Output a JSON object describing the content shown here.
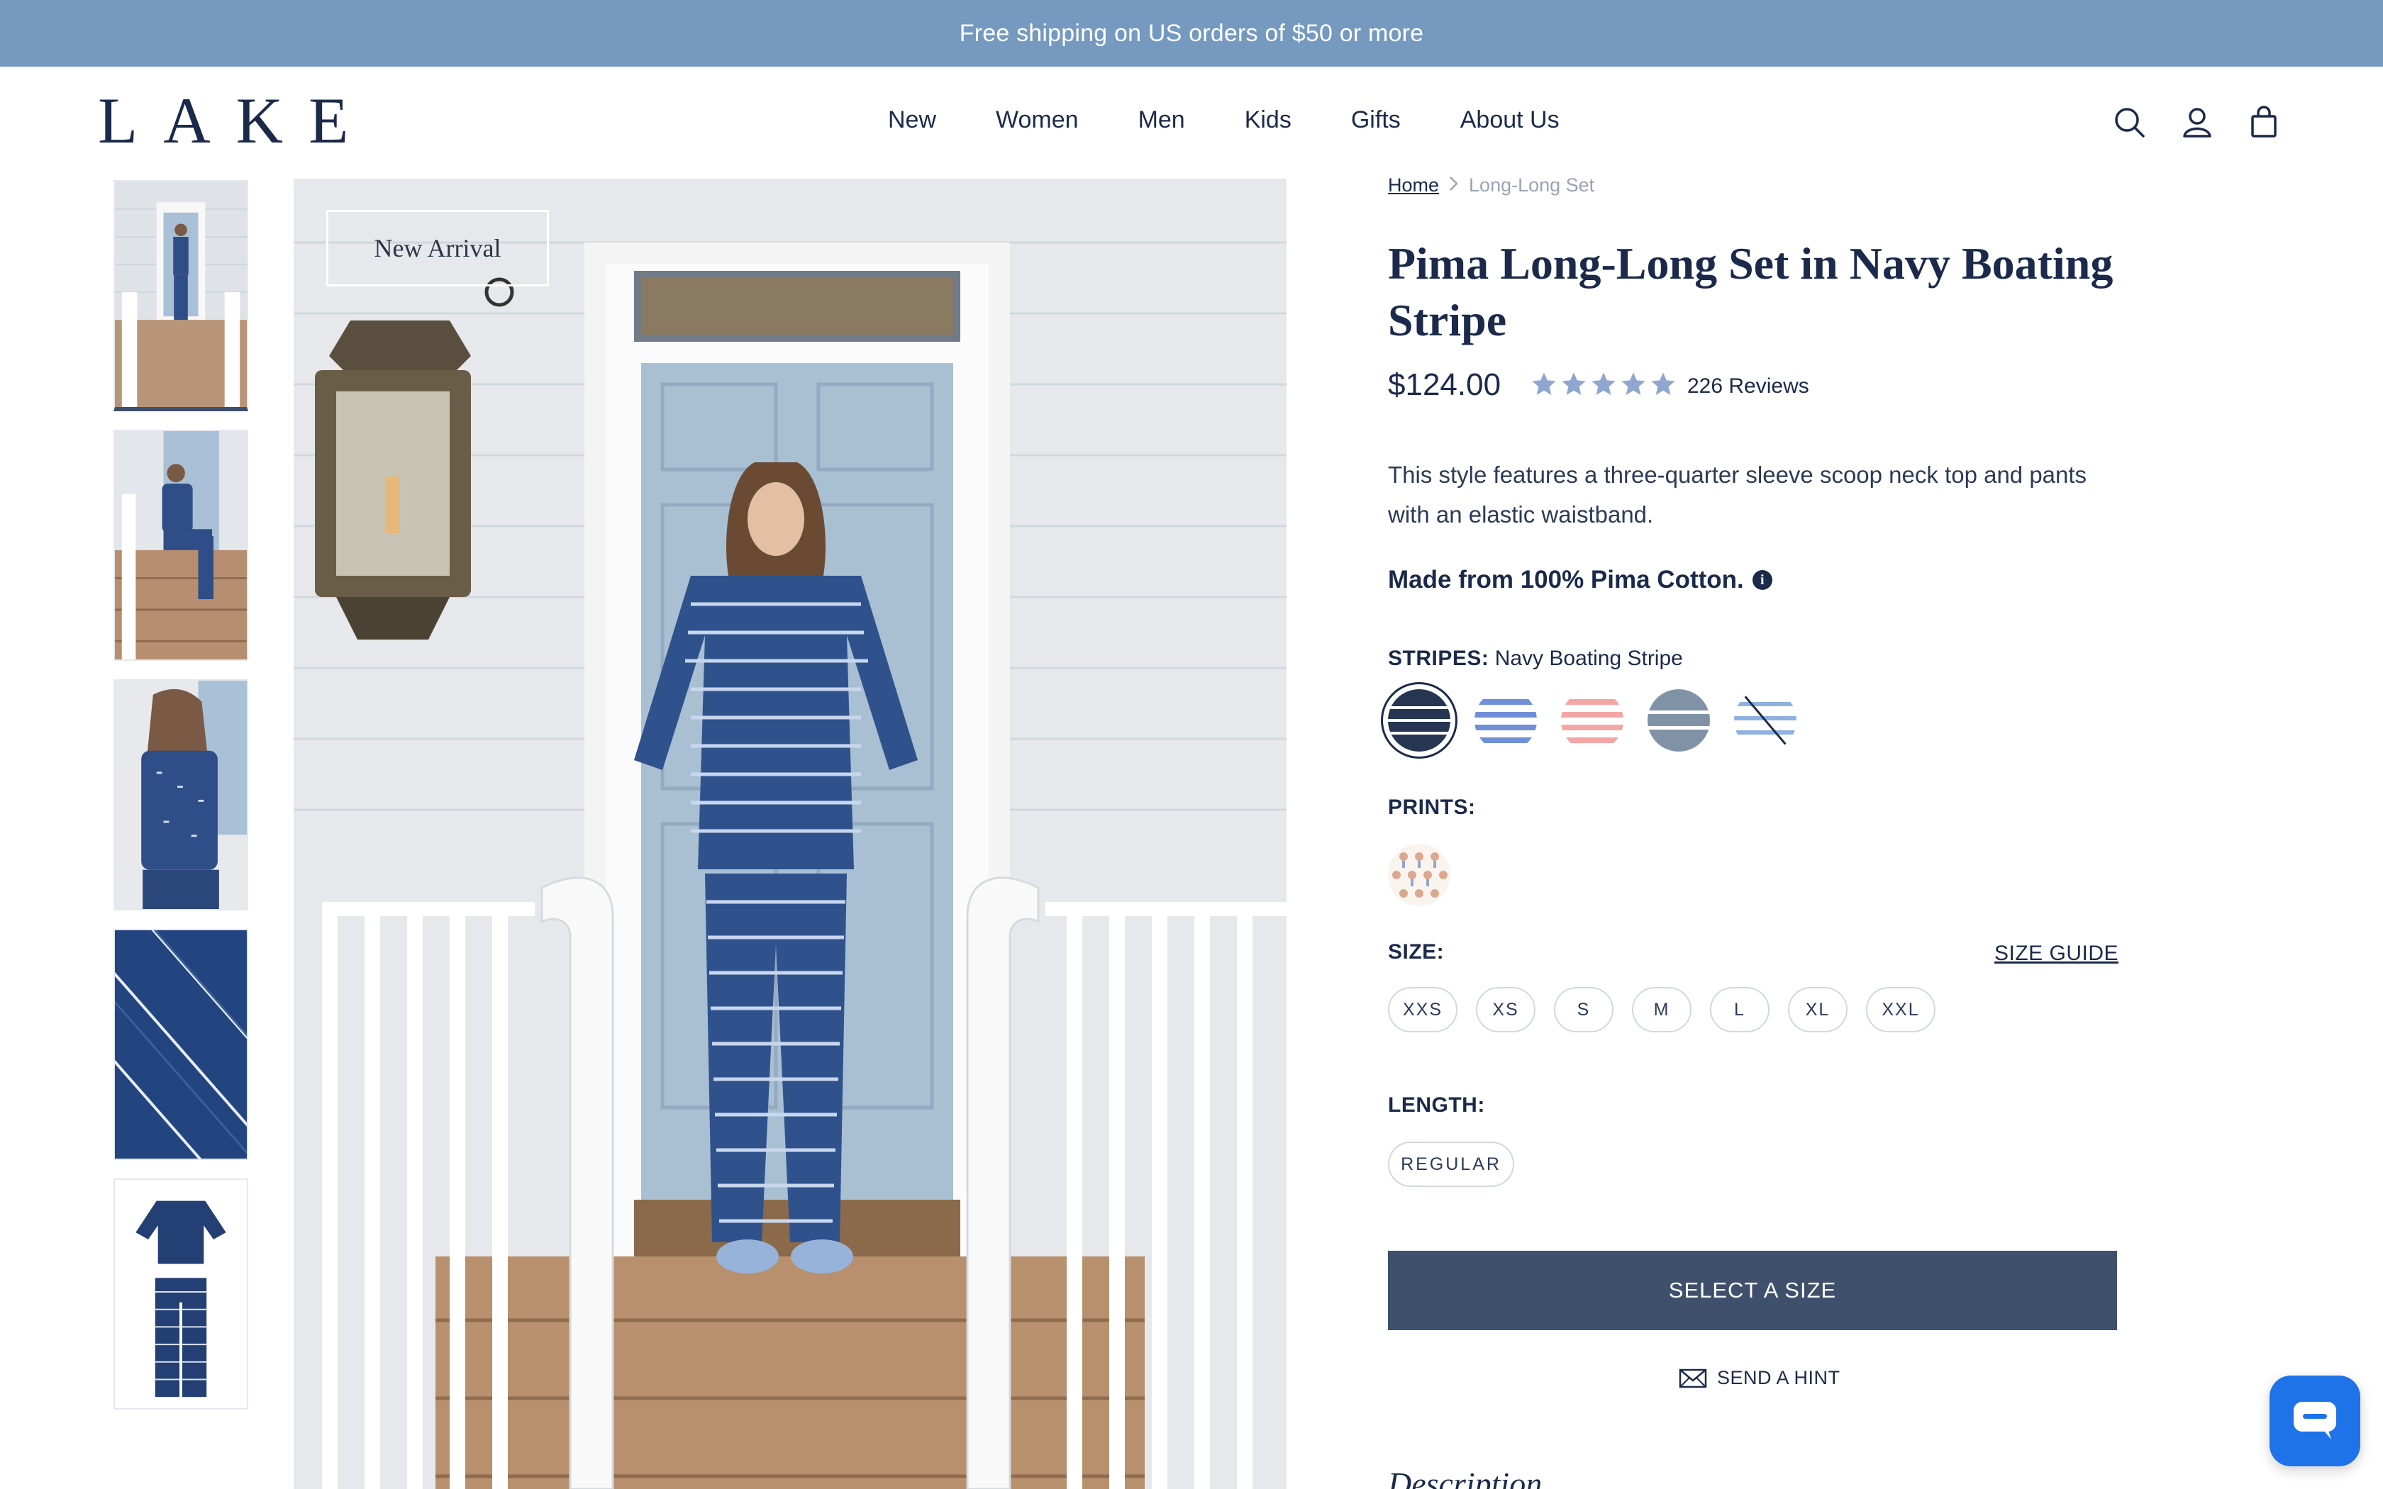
{
  "announcement": {
    "text": "Free shipping on US orders of $50 or more"
  },
  "header": {
    "logo": "LAKE",
    "nav": [
      {
        "label": "New"
      },
      {
        "label": "Women"
      },
      {
        "label": "Men"
      },
      {
        "label": "Kids"
      },
      {
        "label": "Gifts"
      },
      {
        "label": "About Us"
      }
    ],
    "icons": [
      "search-icon",
      "account-icon",
      "bag-icon"
    ]
  },
  "gallery": {
    "badge": "New Arrival",
    "thumbnails": [
      {
        "name": "thumb-front-standing"
      },
      {
        "name": "thumb-seated-steps"
      },
      {
        "name": "thumb-back-view"
      },
      {
        "name": "thumb-fabric-closeup"
      },
      {
        "name": "thumb-flat-lay"
      }
    ],
    "active_thumbnail": 1
  },
  "product": {
    "breadcrumb": {
      "home": "Home",
      "current": "Long-Long Set"
    },
    "title": "Pima Long-Long Set in Navy Boating Stripe",
    "price": "$124.00",
    "rating": 5,
    "reviews": "226 Reviews",
    "description": "This style features a three-quarter sleeve scoop neck top and pants with an elastic waistband.",
    "material": "Made from 100% Pima Cotton.",
    "info_icon": "info-icon",
    "stripes": {
      "label": "STRIPES:",
      "selected": "Navy Boating Stripe",
      "swatches": [
        {
          "name": "navy-boating-stripe",
          "base": "#253552",
          "stripe": "#ffffff",
          "selected": true
        },
        {
          "name": "periwinkle-stripe",
          "base": "#ffffff",
          "stripe": "#6f8fd6",
          "selected": false
        },
        {
          "name": "pink-stripe",
          "base": "#ffffff",
          "stripe": "#f2a6a6",
          "selected": false
        },
        {
          "name": "slate-stripe",
          "base": "#8093a6",
          "stripe": "#ffffff",
          "selected": false
        },
        {
          "name": "sky-stripe-unavailable",
          "base": "#ffffff",
          "stripe": "#8fb0e0",
          "selected": false
        }
      ]
    },
    "prints": {
      "label": "PRINTS:"
    },
    "size": {
      "label": "SIZE:",
      "guide": "SIZE GUIDE",
      "options": [
        "XXS",
        "XS",
        "S",
        "M",
        "L",
        "XL",
        "XXL"
      ]
    },
    "length": {
      "label": "LENGTH:",
      "options": [
        "REGULAR"
      ]
    },
    "cta": "SELECT A SIZE",
    "hint": "SEND A HINT",
    "description_heading": "Description"
  },
  "colors": {
    "announce_bg": "#7599bf",
    "text": "#1b2a4a",
    "cta_bg": "#3f506c",
    "star": "#8fa6cf",
    "chat": "#1e73e8"
  }
}
